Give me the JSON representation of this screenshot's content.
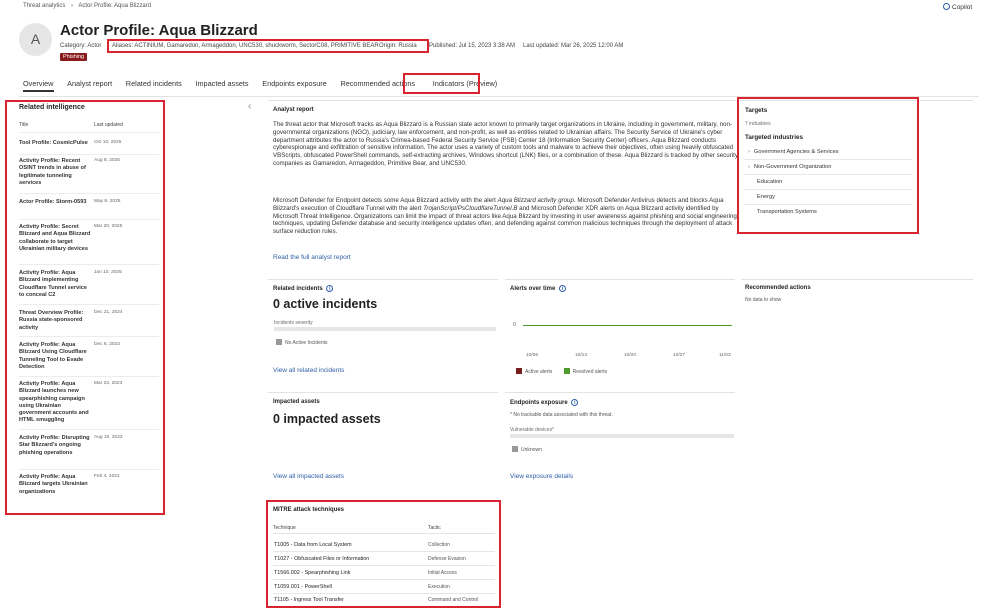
{
  "breadcrumb": {
    "root": "Threat analytics",
    "sep": ">",
    "current": "Actor Profile: Aqua Blizzard"
  },
  "copilot": {
    "label": "Copilot"
  },
  "header": {
    "avatar_letter": "A",
    "title": "Actor Profile: Aqua Blizzard",
    "category": "Category: Actor",
    "aliases": "Aliases: ACTINIUM, Gamaredon, Armageddon, UNC530, shuckworm, SectorC08, PRIMITIVE BEAR",
    "origin": "Origin: Russia",
    "published": "Published: Jul 15, 2023 3:38 AM",
    "updated": "Last updated: Mar 26, 2025 12:00 AM",
    "tag": "Phishing"
  },
  "tabs": [
    {
      "label": "Overview"
    },
    {
      "label": "Analyst report"
    },
    {
      "label": "Related incidents"
    },
    {
      "label": "Impacted assets"
    },
    {
      "label": "Endpoints exposure"
    },
    {
      "label": "Recommended actions"
    },
    {
      "label": "Indicators (Preview)"
    }
  ],
  "related_intelligence": {
    "heading": "Related intelligence",
    "col_title": "Title",
    "col_updated": "Last updated",
    "items": [
      {
        "title": "Tool Profile: CosmicPulse",
        "date": "Oct 10, 2025"
      },
      {
        "title": "Activity Profile: Recent OSINT trends in abuse of legitimate tunneling services",
        "date": "Aug 8, 2025"
      },
      {
        "title": "Actor Profile: Storm-0593",
        "date": "May 8, 2025"
      },
      {
        "title": "Activity Profile: Secret Blizzard and Aqua Blizzard collaborate to target Ukrainian military devices",
        "date": "Mar 20, 2025"
      },
      {
        "title": "Activity Profile: Aqua Blizzard implementing Cloudflare Tunnel service to conceal C2",
        "date": "Jan 10, 2025"
      },
      {
        "title": "Threat Overview Profile: Russia state-sponsored activity",
        "date": "Dec 21, 2024"
      },
      {
        "title": "Activity Profile: Aqua Blizzard Using Cloudflare Tunneling Tool to Evade Detection",
        "date": "Dec 6, 2023"
      },
      {
        "title": "Activity Profile: Aqua Blizzard launches new spearphishing campaign using Ukrainian government accounts and HTML smuggling",
        "date": "Mar 23, 2023"
      },
      {
        "title": "Activity Profile: Disrupting Star Blizzard's ongoing phishing operations",
        "date": "Aug 15, 2022"
      },
      {
        "title": "Activity Profile: Aqua Blizzard targets Ukrainian organizations",
        "date": "Feb 4, 2022"
      }
    ]
  },
  "analyst_report": {
    "heading": "Analyst report",
    "p1": "The threat actor that Microsoft tracks as Aqua Blizzard is a Russian state actor known to primarily target organizations in Ukraine, including in government, military, non-governmental organizations (NGO), judiciary, law enforcement, and non-profit, as well as entities related to Ukrainian affairs. The Security Service of Ukraine's cyber department attributes the actor to Russia's Crimea-based Federal Security Service (FSB) Center 18 (Information Security Center) officers.  Aqua Blizzard conducts cyberespionage and exfiltration of sensitive information. The actor uses a variety of custom tools and malware to achieve their objectives, often using heavily obfuscated VBScripts, obfuscated PowerShell commands, self-extracting archives, Windows shortcut (LNK) files, or a combination of these. Aqua Blizzard is tracked by other security companies as Gamaredon, Armageddon, Primitive Bear, and UNC530.",
    "p2a": "Microsoft Defender for Endpoint detects some Aqua Blizzard activity with the alert ",
    "p2b": "Aqua Blizzard activity group",
    "p2c": ". Microsoft Defender Antivirus detects and blocks Aqua Blizzard's execution of Cloudflare Tunnel with the alert ",
    "p2d": "TrojanScript/PsCloudflareTunnel.B",
    "p2e": " and Microsoft Defender XDR alerts on Aqua Blizzard activity identified by Microsoft Threat Intelligence. Organizations can limit the impact of threat actors like Aqua Blizzard by investing in user awareness against phishing and social engineering techniques, updating Defender database and security intelligence updates often, and defending against common malicious techniques through the deployment of attack surface reduction rules.",
    "read_more": "Read the full analyst report"
  },
  "targets": {
    "heading": "Targets",
    "count": "7 industries",
    "sub": "Targeted industries",
    "items": [
      {
        "label": "Government Agencies & Services",
        "expandable": true
      },
      {
        "label": "Non-Government Organization",
        "expandable": true
      },
      {
        "label": "Education",
        "expandable": false
      },
      {
        "label": "Energy",
        "expandable": false
      },
      {
        "label": "Transportation Systems",
        "expandable": false
      }
    ]
  },
  "related_incidents": {
    "heading": "Related incidents",
    "value": "0 active incidents",
    "severity_label": "Incidents severity",
    "legend": "No Active Incidents",
    "link": "View all related incidents"
  },
  "alerts_over_time": {
    "heading": "Alerts over time",
    "y_zero": "0",
    "x_ticks": [
      "10/06",
      "10/13",
      "10/20",
      "10/27",
      "11/03"
    ],
    "legend_active": "Active alerts",
    "legend_resolved": "Resolved alerts",
    "active_color": "#7a1c1c",
    "resolved_color": "#4f9a2c"
  },
  "recommended_actions": {
    "heading": "Recommended actions",
    "empty": "No data to show"
  },
  "impacted_assets": {
    "heading": "Impacted assets",
    "value": "0 impacted assets",
    "link": "View all impacted assets"
  },
  "endpoints_exposure": {
    "heading": "Endpoints exposure",
    "note": "* No trackable data associated with this threat.",
    "vulnerable": "Vulnerable devices*",
    "legend": "Unknown",
    "link": "View exposure details"
  },
  "mitre": {
    "heading": "MITRE attack techniques",
    "col_technique": "Technique",
    "col_tactic": "Tactic",
    "rows": [
      {
        "technique": "T1005 - Data from Local System",
        "tactic": "Collection"
      },
      {
        "technique": "T1027 - Obfuscated Files or Information",
        "tactic": "Defense Evasion"
      },
      {
        "technique": "T1566.002 - Spearphishing Link",
        "tactic": "Initial Access"
      },
      {
        "technique": "T1059.001 - PowerShell",
        "tactic": "Execution"
      },
      {
        "technique": "T1105 - Ingress Tool Transfer",
        "tactic": "Command and Control"
      }
    ]
  }
}
